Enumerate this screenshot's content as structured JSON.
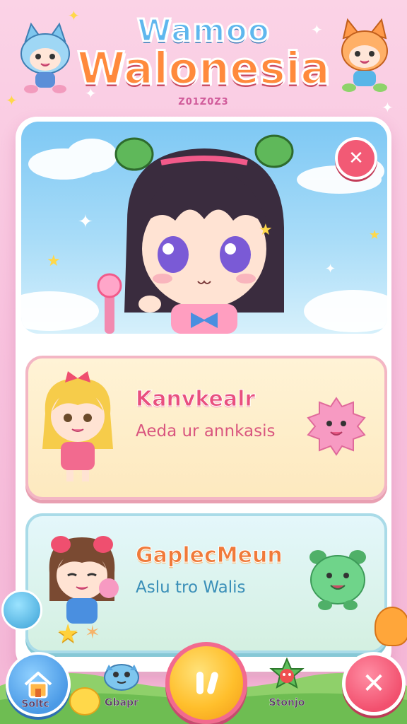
{
  "header": {
    "title_line1": "Wamoo",
    "title_line2": "Walonesia",
    "subtitle": "Z01Z0Z3"
  },
  "hero": {
    "close_icon": "close-icon"
  },
  "cards": [
    {
      "title": "Kanvkealr",
      "subtitle": "Aeda ur annkasis",
      "character": "blonde-girl-character",
      "pet": "pink-blob-pet-icon"
    },
    {
      "title": "GaplecMeun",
      "subtitle": "Aslu tro Walis",
      "character": "brown-hair-girl-character",
      "pet": "green-monster-pet-icon"
    }
  ],
  "bottom_nav": {
    "home_label": "Soltc",
    "pet_label": "Gbapr",
    "shop_label": "Stonjo",
    "play_icon": "pause-icon",
    "close_icon": "close-icon"
  },
  "colors": {
    "background": "#f8c2de",
    "accent_pink": "#f25a75",
    "accent_yellow": "#ffbf2c",
    "accent_blue": "#4b9ae6"
  }
}
